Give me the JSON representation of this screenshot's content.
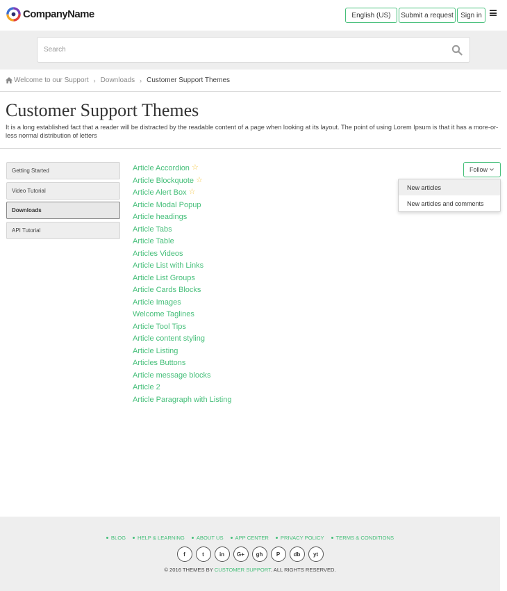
{
  "header": {
    "company_name": "CompanyName",
    "language": "English (US)",
    "submit_request": "Submit a request",
    "sign_in": "Sign in",
    "accent": "#46bf7a"
  },
  "search": {
    "placeholder": "Search"
  },
  "breadcrumb": [
    "Welcome to our Support",
    "Downloads",
    "Customer Support Themes"
  ],
  "page": {
    "title": "Customer Support Themes",
    "description": "It is a long established fact that a reader will be distracted by the readable content of a page when looking at its layout. The point of using Lorem Ipsum is that it has a more-or-less normal distribution of letters"
  },
  "sidebar": {
    "items": [
      {
        "label": "Getting Started",
        "active": false
      },
      {
        "label": "Video Tutorial",
        "active": false
      },
      {
        "label": "Downloads",
        "active": true
      },
      {
        "label": "API Tutorial",
        "active": false
      }
    ]
  },
  "articles": [
    {
      "title": "Article Accordion",
      "promoted": true
    },
    {
      "title": "Article Blockquote",
      "promoted": true
    },
    {
      "title": "Article Alert Box",
      "promoted": true
    },
    {
      "title": "Article Modal Popup",
      "promoted": false
    },
    {
      "title": "Article headings",
      "promoted": false
    },
    {
      "title": "Article Tabs",
      "promoted": false
    },
    {
      "title": "Article Table",
      "promoted": false
    },
    {
      "title": "Articles Videos",
      "promoted": false
    },
    {
      "title": "Article List with Links",
      "promoted": false
    },
    {
      "title": "Article List Groups",
      "promoted": false
    },
    {
      "title": "Article Cards Blocks",
      "promoted": false
    },
    {
      "title": "Article Images",
      "promoted": false
    },
    {
      "title": "Welcome Taglines",
      "promoted": false
    },
    {
      "title": "Article Tool Tips",
      "promoted": false
    },
    {
      "title": "Article content styling",
      "promoted": false
    },
    {
      "title": "Article Listing",
      "promoted": false
    },
    {
      "title": "Articles Buttons",
      "promoted": false
    },
    {
      "title": "Article message blocks",
      "promoted": false
    },
    {
      "title": "Article 2",
      "promoted": false
    },
    {
      "title": "Article Paragraph with Listing",
      "promoted": false
    }
  ],
  "follow": {
    "label": "Follow",
    "options": [
      "New articles",
      "New articles and comments"
    ]
  },
  "footer": {
    "links": [
      "BLOG",
      "HELP & LEARNING",
      "ABOUT US",
      "APP CENTER",
      "PRIVACY POLICY",
      "TERMS & CONDITIONS"
    ],
    "socials": [
      {
        "icon": "facebook-icon",
        "glyph": "f"
      },
      {
        "icon": "twitter-icon",
        "glyph": "t"
      },
      {
        "icon": "linkedin-icon",
        "glyph": "in"
      },
      {
        "icon": "google-plus-icon",
        "glyph": "G+"
      },
      {
        "icon": "github-icon",
        "glyph": "gh"
      },
      {
        "icon": "pinterest-icon",
        "glyph": "P"
      },
      {
        "icon": "dropbox-icon",
        "glyph": "db"
      },
      {
        "icon": "youtube-icon",
        "glyph": "yt"
      }
    ],
    "copyright_prefix": "© 2016 THEMES BY",
    "copyright_brand": "CUSTOMER SUPPORT",
    "copyright_suffix": ". ALL RIGHTS RESERVED."
  }
}
